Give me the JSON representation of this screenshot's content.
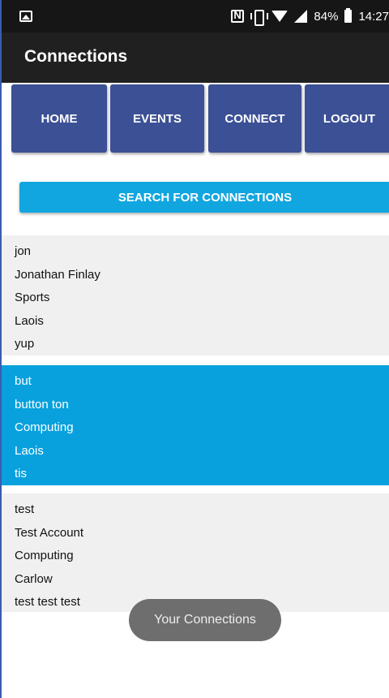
{
  "status_bar": {
    "battery_percent": "84%",
    "time": "14:27",
    "icons": [
      "image-icon",
      "nfc-icon",
      "vibrate-icon",
      "wifi-icon",
      "signal-icon",
      "battery-icon"
    ]
  },
  "app_bar": {
    "title": "Connections"
  },
  "nav": {
    "home": "HOME",
    "events": "EVENTS",
    "connect": "CONNECT",
    "logout": "LOGOUT"
  },
  "search": {
    "label": "SEARCH FOR CONNECTIONS"
  },
  "connections": [
    {
      "username": "jon",
      "full_name": "Jonathan Finlay",
      "interest": "Sports",
      "county": "Laois",
      "bio": "yup"
    },
    {
      "username": "but",
      "full_name": "button ton",
      "interest": "Computing",
      "county": "Laois",
      "bio": "tis"
    },
    {
      "username": "test",
      "full_name": "Test Account",
      "interest": "Computing",
      "county": "Carlow",
      "bio": "test test test"
    }
  ],
  "toast": {
    "message": "Your Connections"
  },
  "colors": {
    "status_bar": "#161616",
    "app_bar": "#202020",
    "nav_button": "#3b5095",
    "search_button": "#12a6e0",
    "selected_item": "#08a1dd",
    "list_item": "#f0f0f0",
    "toast": "#6e6e6e"
  }
}
